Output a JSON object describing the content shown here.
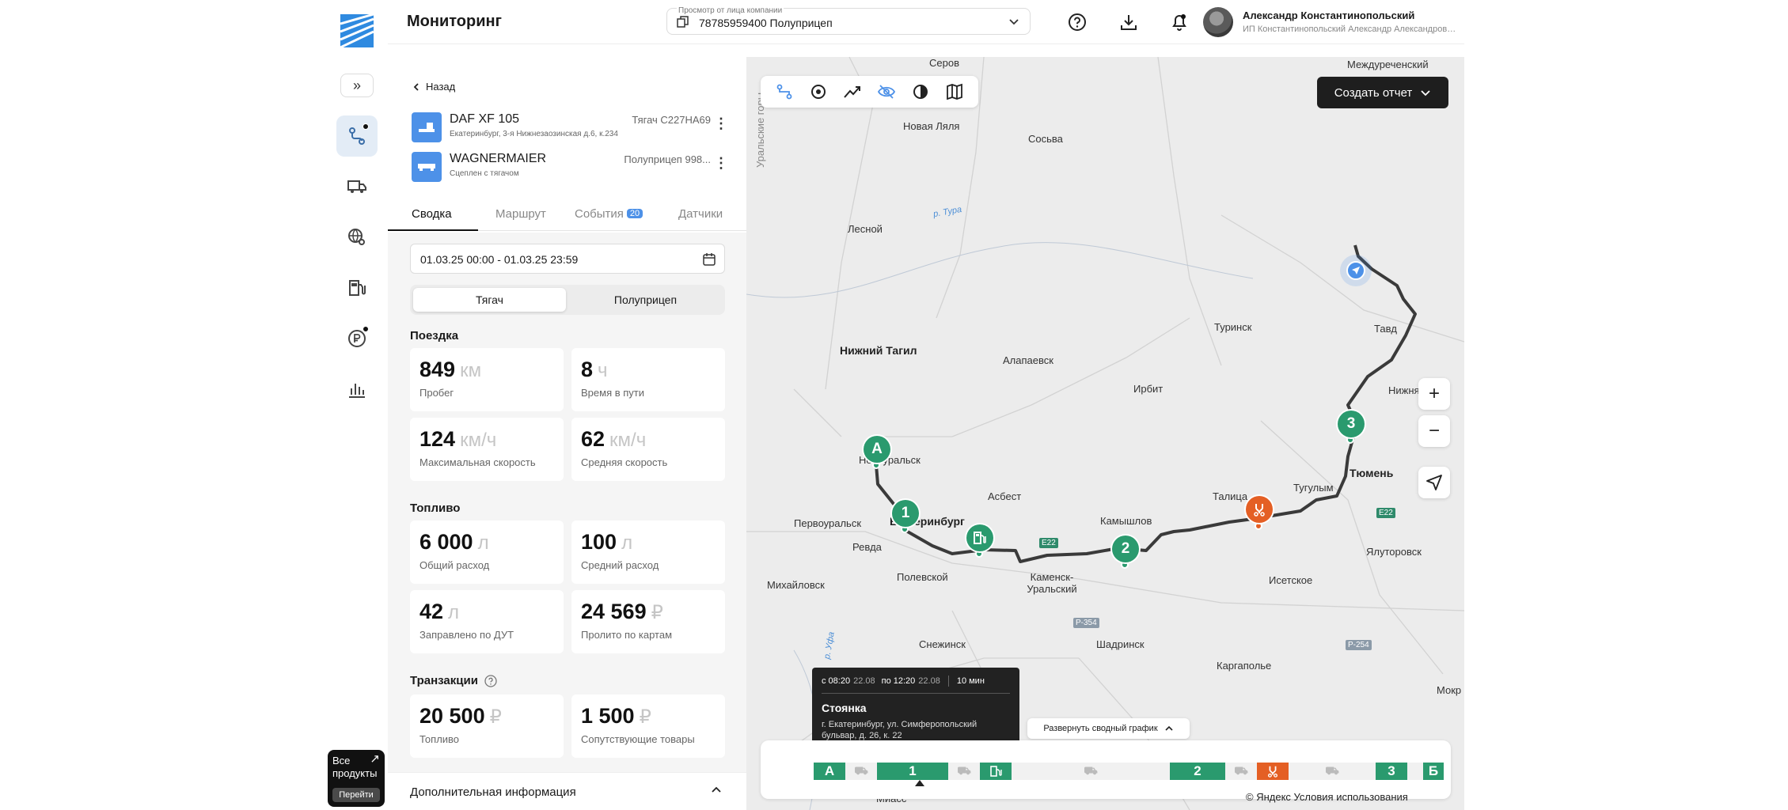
{
  "header": {
    "title": "Мониторинг",
    "company_caption": "Просмотр от лица компании",
    "company_value": "78785959400 Полуприцеп",
    "user_name": "Александр Константинопольский",
    "user_org": "ИП Константинопольский Александр Александрович"
  },
  "sidebar": {
    "all_products": "Все продукты",
    "go_label": "Перейти",
    "icons": [
      "route-icon",
      "truck-icon",
      "globe-search-icon",
      "fuel-station-icon",
      "ruble-icon",
      "bar-chart-icon"
    ]
  },
  "panel": {
    "back_label": "Назад",
    "vehicles": [
      {
        "name": "DAF XF 105",
        "sub": "Екатеринбург, 3-я Нижнезаозинская д.6, к.234",
        "plate": "Тягач С227НА69"
      },
      {
        "name": "WAGNERMAIER",
        "sub": "Сцеплен с тягачом",
        "plate": "Полуприцеп 998..."
      }
    ],
    "tabs": [
      {
        "label": "Сводка"
      },
      {
        "label": "Маршрут"
      },
      {
        "label": "События",
        "badge": "20"
      },
      {
        "label": "Датчики"
      }
    ],
    "date_range": "01.03.25 00:00 - 01.03.25 23:59",
    "segment": {
      "on": "Тягач",
      "off": "Полуприцеп"
    },
    "sections": {
      "trip": "Поездка",
      "fuel": "Топливо",
      "transactions": "Транзакции"
    },
    "trip_cards": [
      {
        "value": "849",
        "unit": "км",
        "label": "Пробег"
      },
      {
        "value": "8",
        "unit": "ч",
        "label": "Время в пути"
      },
      {
        "value": "124",
        "unit": "км/ч",
        "label": "Максимальная скорость"
      },
      {
        "value": "62",
        "unit": "км/ч",
        "label": "Средняя скорость"
      }
    ],
    "fuel_cards": [
      {
        "value": "6 000",
        "unit": "л",
        "label": "Общий расход"
      },
      {
        "value": "100",
        "unit": "л",
        "label": "Средний расход"
      },
      {
        "value": "42",
        "unit": "л",
        "label": "Заправлено по ДУТ"
      },
      {
        "value": "24 569",
        "unit": "₽",
        "label": "Пролито по картам"
      }
    ],
    "transaction_cards": [
      {
        "value": "20 500",
        "unit": "₽",
        "label": "Топливо"
      },
      {
        "value": "1 500",
        "unit": "₽",
        "label": "Сопутствующие товары"
      }
    ],
    "more_info": "Дополнительная информация"
  },
  "map": {
    "report_button": "Создать отчет",
    "zoom_in": "+",
    "zoom_out": "−",
    "cities": {
      "serov": "Серов",
      "mezhdurechensky": "Междуреченский",
      "novaya_lyalya": "Новая Ляля",
      "sosva": "Сосьва",
      "lesnoy": "Лесной",
      "nizhny_tagil": "Нижний Тагил",
      "alapaevsk": "Алапаевск",
      "turinsk": "Туринск",
      "tavda": "Тавд",
      "irbit": "Ирбит",
      "nizhnyaya": "Нижня",
      "novouralsk": "Новоуральск",
      "tyumen": "Тюмень",
      "asbest": "Асбест",
      "talitsa": "Талица",
      "tugulym": "Тугулым",
      "pervouralsk": "Первоуральск",
      "ekaterinburg": "Екатеринбург",
      "kamyshlov": "Камышлов",
      "revda": "Ревда",
      "polevskoy": "Полевской",
      "kamensk": "Каменск-Уральский",
      "yalutorovsk": "Ялуторовск",
      "mikhaylovsk": "Михайловск",
      "isetskoe": "Исетское",
      "snezhinsk": "Снежинск",
      "shadrinsk": "Шадринск",
      "kargapolye": "Каргаполье",
      "mokr": "Мокр",
      "miass": "Миасс"
    },
    "ridge_label": "Уральские горы",
    "rivers": {
      "tura": "р. Тура",
      "ufa": "р. Уфа"
    },
    "roads": {
      "e22a": "E22",
      "e22b": "E22",
      "p354": "Р-354",
      "p254": "Р-254"
    },
    "pins": {
      "a": "A",
      "one": "1",
      "two": "2",
      "three": "3"
    },
    "tooltip": {
      "from": "с 08:20",
      "from_date": "22.08",
      "to": "по 12:20",
      "to_date": "22.08",
      "duration": "10 мин",
      "title": "Стоянка",
      "address": "г. Екатеринбург, ул. Симферопольский бульвар, д. 26, к. 22"
    },
    "expand_chart": "Развернуть сводный график",
    "timeline": {
      "a": "A",
      "one": "1",
      "two": "2",
      "three": "3",
      "b": "Б"
    },
    "attribution": "© Яндекс Условия использования",
    "colors": {
      "green": "#2a9a6e",
      "orange": "#e45f24",
      "blue": "#4d91e8",
      "route": "#3a3a3a"
    }
  }
}
